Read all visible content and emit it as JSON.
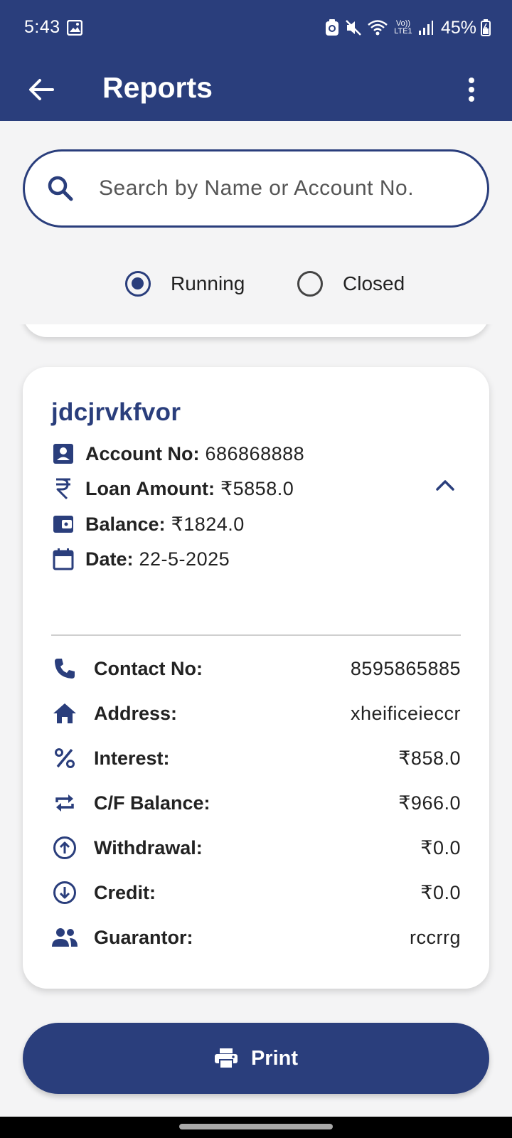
{
  "status_bar": {
    "time": "5:43",
    "battery": "45%",
    "network": "Vo)) LTE1"
  },
  "app_bar": {
    "title": "Reports"
  },
  "search": {
    "placeholder": "Search by Name or Account No.",
    "value": ""
  },
  "filter": {
    "options": [
      {
        "label": "Running",
        "selected": true
      },
      {
        "label": "Closed",
        "selected": false
      }
    ]
  },
  "card": {
    "name": "jdcjrvkfvor",
    "summary": [
      {
        "icon": "account-box-icon",
        "label": "Account No:",
        "value": "686868888"
      },
      {
        "icon": "rupee-icon",
        "label": "Loan Amount:",
        "value": "₹5858.0"
      },
      {
        "icon": "wallet-icon",
        "label": "Balance:",
        "value": "₹1824.0"
      },
      {
        "icon": "calendar-icon",
        "label": "Date:",
        "value": "22-5-2025"
      }
    ],
    "details": [
      {
        "icon": "phone-icon",
        "label": "Contact No:",
        "value": "8595865885"
      },
      {
        "icon": "home-icon",
        "label": "Address:",
        "value": "xheificeieccr"
      },
      {
        "icon": "percent-icon",
        "label": "Interest:",
        "value": "₹858.0"
      },
      {
        "icon": "swap-icon",
        "label": "C/F Balance:",
        "value": "₹966.0"
      },
      {
        "icon": "arrow-up-circle-icon",
        "label": "Withdrawal:",
        "value": "₹0.0"
      },
      {
        "icon": "arrow-down-circle-icon",
        "label": "Credit:",
        "value": "₹0.0"
      },
      {
        "icon": "people-icon",
        "label": "Guarantor:",
        "value": "rccrrg"
      }
    ]
  },
  "print_button": {
    "label": "Print"
  },
  "colors": {
    "primary": "#2a3e7c",
    "background": "#f4f4f5",
    "card": "#ffffff"
  }
}
